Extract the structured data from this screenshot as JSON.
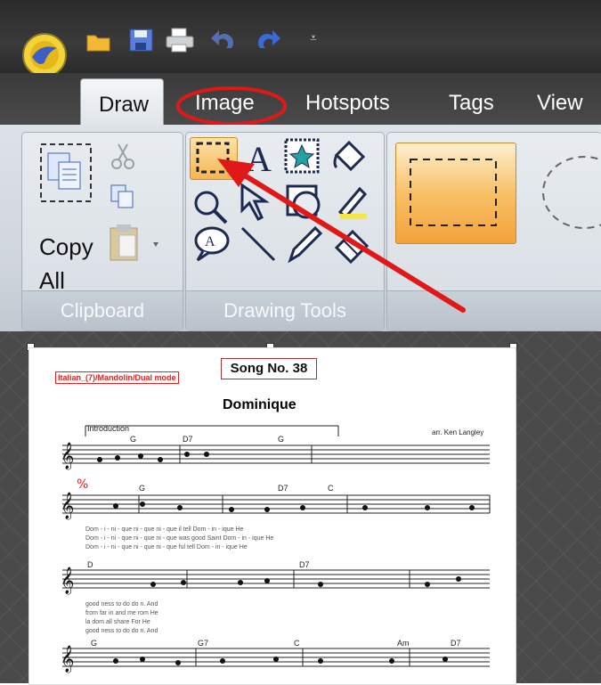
{
  "tabs": [
    "Draw",
    "Image",
    "Hotspots",
    "Tags",
    "View"
  ],
  "quick_access": {
    "icons": [
      "app-logo-icon",
      "open-folder-icon",
      "save-icon",
      "print-icon",
      "undo-icon",
      "redo-icon",
      "customize-icon"
    ]
  },
  "clipboard": {
    "copy_all_label": "Copy\nAll",
    "group_label": "Clipboard"
  },
  "drawing_tools": {
    "group_label": "Drawing Tools"
  },
  "document": {
    "song_number": "Song No. 38",
    "category": "Italian_(7)/Mandolin/Dual mode",
    "song_title": "Dominique",
    "section_label": "Introduction",
    "arranger": "arr. Ken Langley",
    "chords_row1": [
      "G",
      "D7",
      "G"
    ],
    "chords_row2": [
      "G",
      "D7",
      "C"
    ],
    "chords_row3": [
      "D",
      "D7"
    ],
    "chords_row4": [
      "G",
      "G7",
      "C",
      "Am",
      "D7"
    ]
  },
  "colors": {
    "annotation_red": "#e01818",
    "selected_tool": "#f6b552"
  }
}
